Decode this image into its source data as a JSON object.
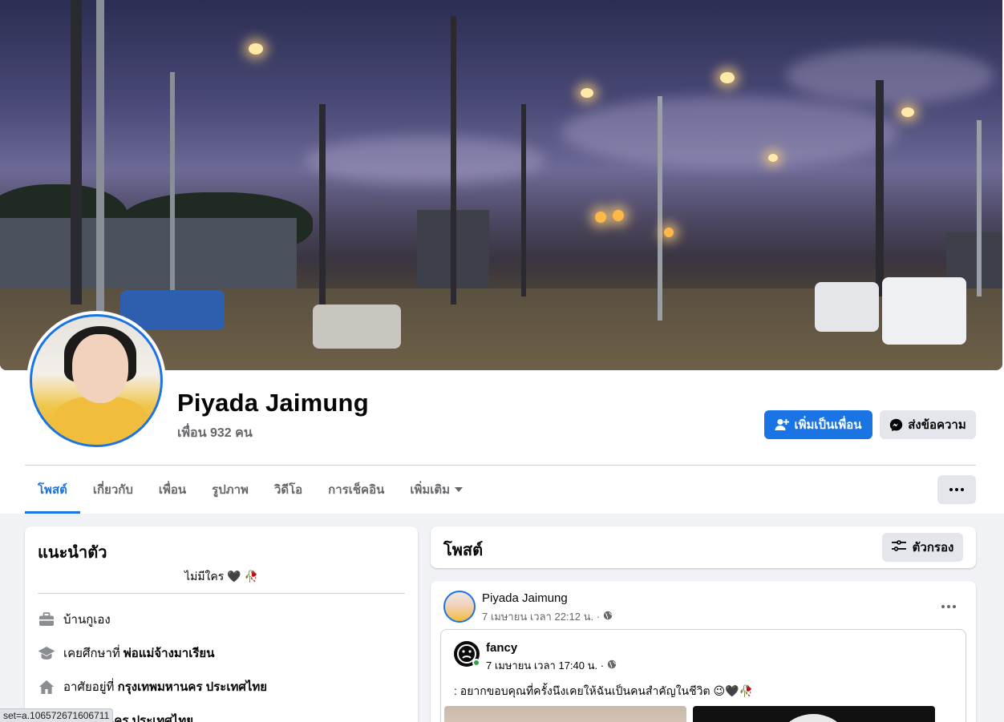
{
  "profile": {
    "name": "Piyada Jaimung",
    "friends": "เพื่อน 932 คน"
  },
  "actions": {
    "add_friend": "เพิ่มเป็นเพื่อน",
    "message": "ส่งข้อความ"
  },
  "tabs": [
    {
      "label": "โพสต์",
      "active": true
    },
    {
      "label": "เกี่ยวกับ"
    },
    {
      "label": "เพื่อน"
    },
    {
      "label": "รูปภาพ"
    },
    {
      "label": "วิดีโอ"
    },
    {
      "label": "การเช็คอิน"
    },
    {
      "label": "เพิ่มเติม"
    }
  ],
  "intro": {
    "title": "แนะนำตัว",
    "bio": "ไม่มีใคร 🖤 🥀",
    "work": "บ้านกูเอง",
    "education_prefix": "เคยศึกษาที่ ",
    "education": "พ่อแม่จ้างมาเรียน",
    "lives_prefix": "อาศัยอยู่ที่ ",
    "lives": "กรุงเทพมหานคร ประเทศไทย",
    "from": "เทพมหานคร ประเทศไทย"
  },
  "posts_section": {
    "title": "โพสต์",
    "filter_label": "ตัวกรอง"
  },
  "post": {
    "author": "Piyada Jaimung",
    "time": "7 เมษายน เวลา 22:12 น. ·",
    "shared": {
      "author": "fancy",
      "time": "7 เมษายน เวลา 17:40 น. ·",
      "text": ": อยากขอบคุณที่ครั้งนึงเคยให้ฉันเป็นคนสำคัญในชีวิต 😉🖤🥀"
    }
  },
  "status_bar": "set=a.106572671606711",
  "colors": {
    "accent": "#1b74e4",
    "secondary_bg": "#e4e6eb",
    "page_bg": "#f0f2f5",
    "online": "#31a24c"
  },
  "icons": [
    "add-friend-icon",
    "messenger-icon",
    "more-dots-icon",
    "filter-icon",
    "briefcase-icon",
    "graduation-cap-icon",
    "home-icon",
    "globe-icon",
    "caret-down-icon"
  ]
}
